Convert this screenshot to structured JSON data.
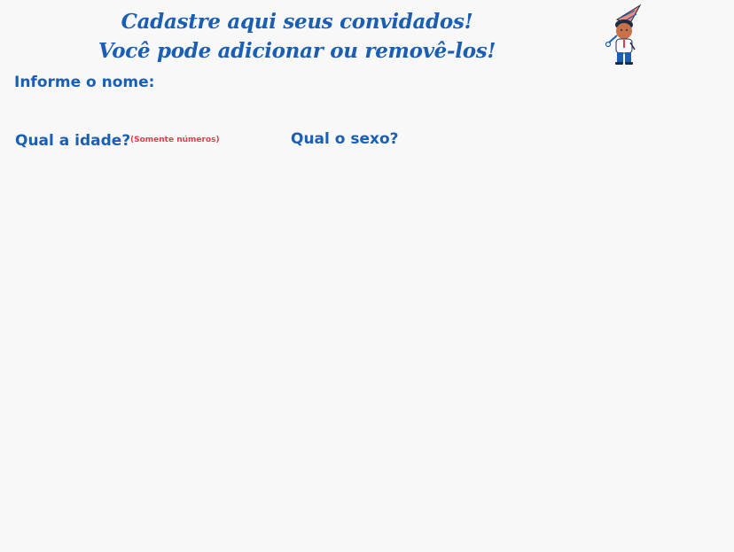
{
  "header": {
    "title_line1": "Cadastre aqui seus convidados!",
    "title_line2": "Você pode adicionar ou removê-los!"
  },
  "mascot": {
    "icon": "party-boy-with-hat-icon"
  },
  "form": {
    "name_label": "Informe o nome:",
    "age_label": "Qual a idade?",
    "age_hint": "(Somente números)",
    "sex_label": "Qual o sexo?"
  },
  "colors": {
    "primary": "#1a5fb4",
    "hint": "#e8394a",
    "background": "#f8f8f8"
  }
}
